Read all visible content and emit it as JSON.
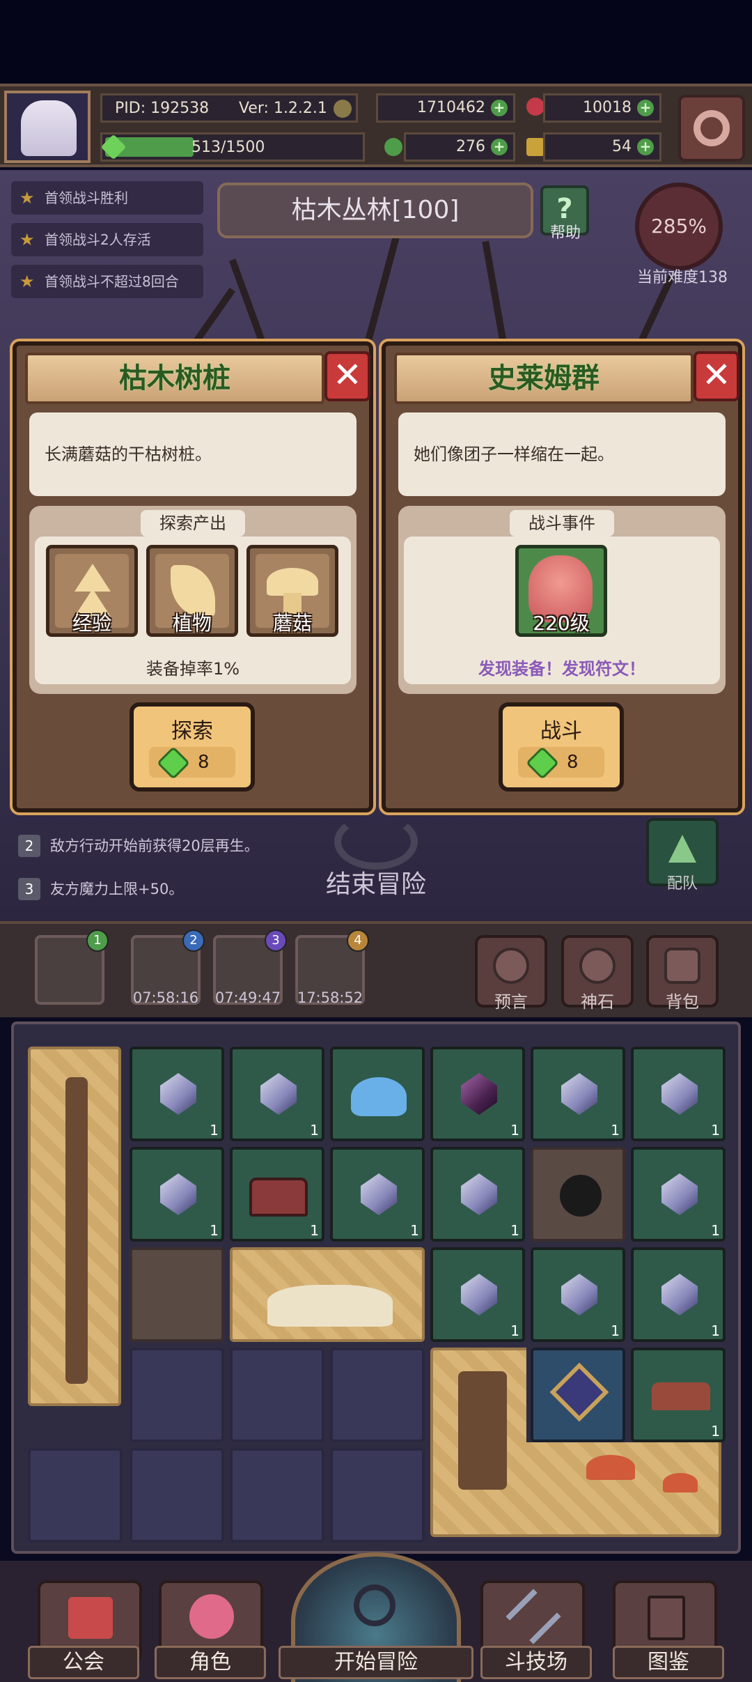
{
  "hud": {
    "pid": "PID: 192538",
    "version": "Ver: 1.2.2.1",
    "gold": "1710462",
    "gems": "10018",
    "stamina": "513/1500",
    "clover": "276",
    "keys": "54",
    "stamina_fraction": 0.342
  },
  "objectives": [
    {
      "label": "首领战斗胜利"
    },
    {
      "label": "首领战斗2人存活"
    },
    {
      "label": "首领战斗不超过8回合"
    }
  ],
  "zone": {
    "title": "枯木丛林[100]",
    "help_label": "帮助",
    "help_symbol": "?",
    "difficulty_percent": "285%",
    "difficulty_label": "当前难度138"
  },
  "card_left": {
    "title": "枯木树桩",
    "close_symbol": "✕",
    "description": "长满蘑菇的干枯树桩。",
    "section_label": "探索产出",
    "items": [
      {
        "label": "经验",
        "icon": "arrow-up-icon"
      },
      {
        "label": "植物",
        "icon": "leaf-icon"
      },
      {
        "label": "蘑菇",
        "icon": "mushroom-icon"
      }
    ],
    "drop_rate": "装备掉率1%",
    "action_label": "探索",
    "action_cost": "8"
  },
  "card_right": {
    "title": "史莱姆群",
    "close_symbol": "✕",
    "description": "她们像团子一样缩在一起。",
    "section_label": "战斗事件",
    "enemy_level": "220级",
    "discovery": "发现装备！发现符文！",
    "action_label": "战斗",
    "action_cost": "8"
  },
  "buffs": [
    {
      "num": "2",
      "text": "敌方行动开始前获得20层再生。"
    },
    {
      "num": "3",
      "text": "友方魔力上限+50。"
    }
  ],
  "end_adventure": "结束冒险",
  "team_label": "配队",
  "slots": [
    {
      "badge": "1",
      "timer": ""
    },
    {
      "badge": "2",
      "timer": "07:58:16"
    },
    {
      "badge": "3",
      "timer": "07:49:47"
    },
    {
      "badge": "4",
      "timer": "17:58:52"
    }
  ],
  "side_buttons": [
    {
      "label": "预言"
    },
    {
      "label": "神石"
    },
    {
      "label": "背包"
    }
  ],
  "inventory_qty": "1",
  "nav": [
    {
      "label": "公会"
    },
    {
      "label": "角色"
    },
    {
      "label": "开始冒险"
    },
    {
      "label": "斗技场"
    },
    {
      "label": "图鉴"
    }
  ],
  "colors": {
    "accent_green": "#5fce4a",
    "close_red": "#c93a3a",
    "discovery_purple": "#8a5ab8",
    "card_title_green": "#2a5a22"
  }
}
